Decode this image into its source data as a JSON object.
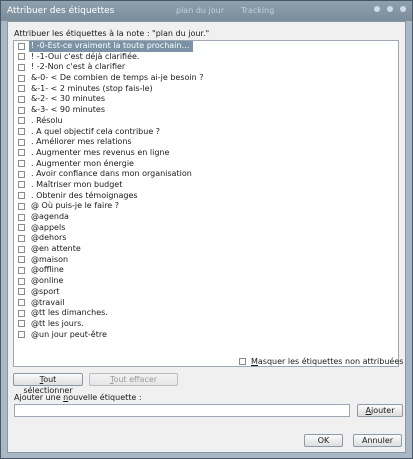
{
  "window": {
    "title": "Attribuer des étiquettes",
    "background_text": [
      "plan du jour",
      "Tracking"
    ]
  },
  "prompt": "Attribuer les étiquettes à la note : \"plan du jour.\"",
  "tags": [
    {
      "label": "! -0-Est-ce vraiment la toute prochaine actio...",
      "checked": false,
      "selected": true
    },
    {
      "label": "! -1-Oui c'est déjà clarifiée.",
      "checked": false
    },
    {
      "label": "! -2-Non c'est à clarifier",
      "checked": false
    },
    {
      "label": "&-0- <  De combien de temps ai-je besoin ?",
      "checked": false
    },
    {
      "label": "&-1- < 2 minutes (stop fais-le)",
      "checked": false
    },
    {
      "label": "&-2- < 30 minutes",
      "checked": false
    },
    {
      "label": "&-3- < 90 minutes",
      "checked": false
    },
    {
      "label": ".  Résolu",
      "checked": false
    },
    {
      "label": ".  A quel objectif cela contribue ?",
      "checked": false
    },
    {
      "label": ". Améliorer mes relations",
      "checked": false
    },
    {
      "label": ". Augmenter mes revenus en ligne",
      "checked": false
    },
    {
      "label": ". Augmenter mon énergie",
      "checked": false
    },
    {
      "label": ". Avoir confiance dans mon organisation",
      "checked": false
    },
    {
      "label": ". Maîtriser mon budget",
      "checked": false
    },
    {
      "label": ". Obtenir des témoignages",
      "checked": false
    },
    {
      "label": "@ Où puis-je le faire ?",
      "checked": false
    },
    {
      "label": "@agenda",
      "checked": false
    },
    {
      "label": "@appels",
      "checked": false
    },
    {
      "label": "@dehors",
      "checked": false
    },
    {
      "label": "@en attente",
      "checked": false
    },
    {
      "label": "@maison",
      "checked": false
    },
    {
      "label": "@offline",
      "checked": false
    },
    {
      "label": "@online",
      "checked": false
    },
    {
      "label": "@sport",
      "checked": false
    },
    {
      "label": "@travail",
      "checked": false
    },
    {
      "label": "@tt les dimanches.",
      "checked": false
    },
    {
      "label": "@tt les jours.",
      "checked": false
    },
    {
      "label": "@un jour peut-être",
      "checked": false
    }
  ],
  "hide_unassigned": {
    "label_pre": "",
    "mnemonic": "M",
    "label_post": "asquer les étiquettes non attribuées",
    "checked": false
  },
  "select_all_button": {
    "mnemonic": "T",
    "rest": "out sélectionner"
  },
  "clear_all_button": {
    "mnemonic": "T",
    "rest": "out effacer",
    "enabled": false
  },
  "new_tag": {
    "label_pre": "Ajouter une ",
    "mnemonic": "n",
    "label_post": "ouvelle étiquette :",
    "value": "",
    "add_button": {
      "mnemonic": "A",
      "rest": "jouter"
    }
  },
  "ok_button": "OK",
  "cancel_button": "Annuler",
  "colors": {
    "selection": "#7c93a7",
    "frame": "#a9b8c4"
  }
}
